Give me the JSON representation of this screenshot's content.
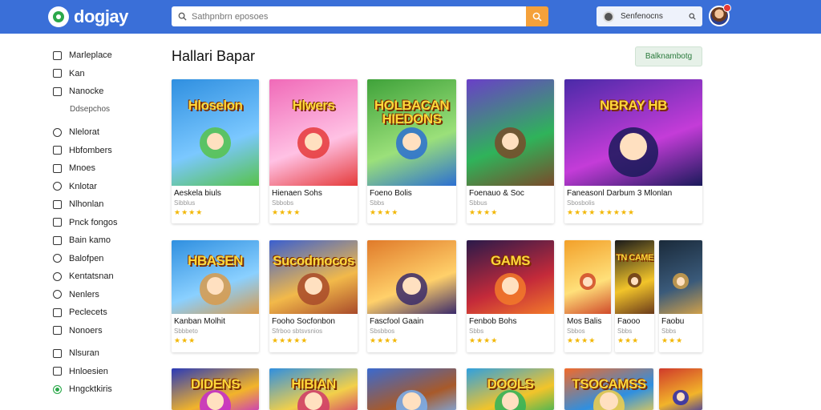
{
  "brand": {
    "name": "dogjay"
  },
  "search": {
    "placeholder": "Sathpnbrn eposoes"
  },
  "user": {
    "name": "Senfenocns"
  },
  "sidebar": {
    "items": [
      {
        "label": "Marleplace",
        "type": "item"
      },
      {
        "label": "Kan",
        "type": "item"
      },
      {
        "label": "Nanocke",
        "type": "item"
      },
      {
        "label": "Ddsepchos",
        "type": "sub"
      },
      {
        "label": "Nlelorat",
        "type": "item"
      },
      {
        "label": "Hbfombers",
        "type": "item"
      },
      {
        "label": "Mnoes",
        "type": "item"
      },
      {
        "label": "Knlotar",
        "type": "item"
      },
      {
        "label": "Nlhonlan",
        "type": "item"
      },
      {
        "label": "Pnck fongos",
        "type": "item"
      },
      {
        "label": "Bain kamo",
        "type": "item"
      },
      {
        "label": "Balofpen",
        "type": "item"
      },
      {
        "label": "Kentatsnan",
        "type": "item"
      },
      {
        "label": "Nenlers",
        "type": "item"
      },
      {
        "label": "Peclecets",
        "type": "item"
      },
      {
        "label": "Nonoers",
        "type": "item"
      },
      {
        "label": "Nlsuran",
        "type": "item"
      },
      {
        "label": "Hnloesien",
        "type": "item"
      },
      {
        "label": "Hngcktkiris",
        "type": "item"
      }
    ]
  },
  "page": {
    "title": "Hallari Bapar",
    "action_label": "Balknambotg"
  },
  "cards": [
    {
      "art": "Hloselon",
      "title": "Aeskela biuls",
      "sub": "Sibblus",
      "stars": "★★★★"
    },
    {
      "art": "Hlwers",
      "title": "Hienaen Sohs",
      "sub": "Sbbobs",
      "stars": "★★★★"
    },
    {
      "art": "HOLBACAN HIEDONS",
      "title": "Foeno Bolis",
      "sub": "Sbbs",
      "stars": "★★★★"
    },
    {
      "art": "",
      "title": "Foenauo & Soc",
      "sub": "Sbbus",
      "stars": "★★★★"
    },
    {
      "art": "NBRAY HB",
      "title": "Faneasonl Darbum 3 Mlonlan",
      "sub": "Sbosbolis",
      "stars": "★★★★ ★★★★★"
    },
    {
      "art": "HBASEN",
      "title": "Kanban Molhit",
      "sub": "Sbbbeto",
      "stars": "★★★"
    },
    {
      "art": "Sucodmocos",
      "title": "Fooho Socfonbon",
      "sub": "Sfrboo sbtsvsnios",
      "stars": "★★★★★"
    },
    {
      "art": "",
      "title": "Fascfool Gaain",
      "sub": "Sbsbbos",
      "stars": "★★★★"
    },
    {
      "art": "GAMS",
      "title": "Fenbob Bohs",
      "sub": "Sbbs",
      "stars": "★★★★"
    },
    {
      "art": "",
      "title": "Mos Balis",
      "sub": "Sbbos",
      "stars": "★★★★"
    },
    {
      "art": "TN CAME",
      "title": "Faooo",
      "sub": "Sbbs",
      "stars": "★★★"
    },
    {
      "art": "",
      "title": "Faobu",
      "sub": "Sbbs",
      "stars": "★★★"
    },
    {
      "art": "DIDENS",
      "title": "",
      "sub": "",
      "stars": ""
    },
    {
      "art": "HIBIAN",
      "title": "",
      "sub": "",
      "stars": ""
    },
    {
      "art": "",
      "title": "",
      "sub": "",
      "stars": ""
    },
    {
      "art": "DOOLS",
      "title": "",
      "sub": "",
      "stars": ""
    },
    {
      "art": "TSOCAMSS",
      "title": "",
      "sub": "",
      "stars": ""
    },
    {
      "art": "",
      "title": "",
      "sub": "",
      "stars": ""
    }
  ],
  "colors": {
    "topbar": "#3a6fd8",
    "search_button": "#f5a13a",
    "action_button": "#e6f1e8",
    "star": "#f2b705"
  }
}
